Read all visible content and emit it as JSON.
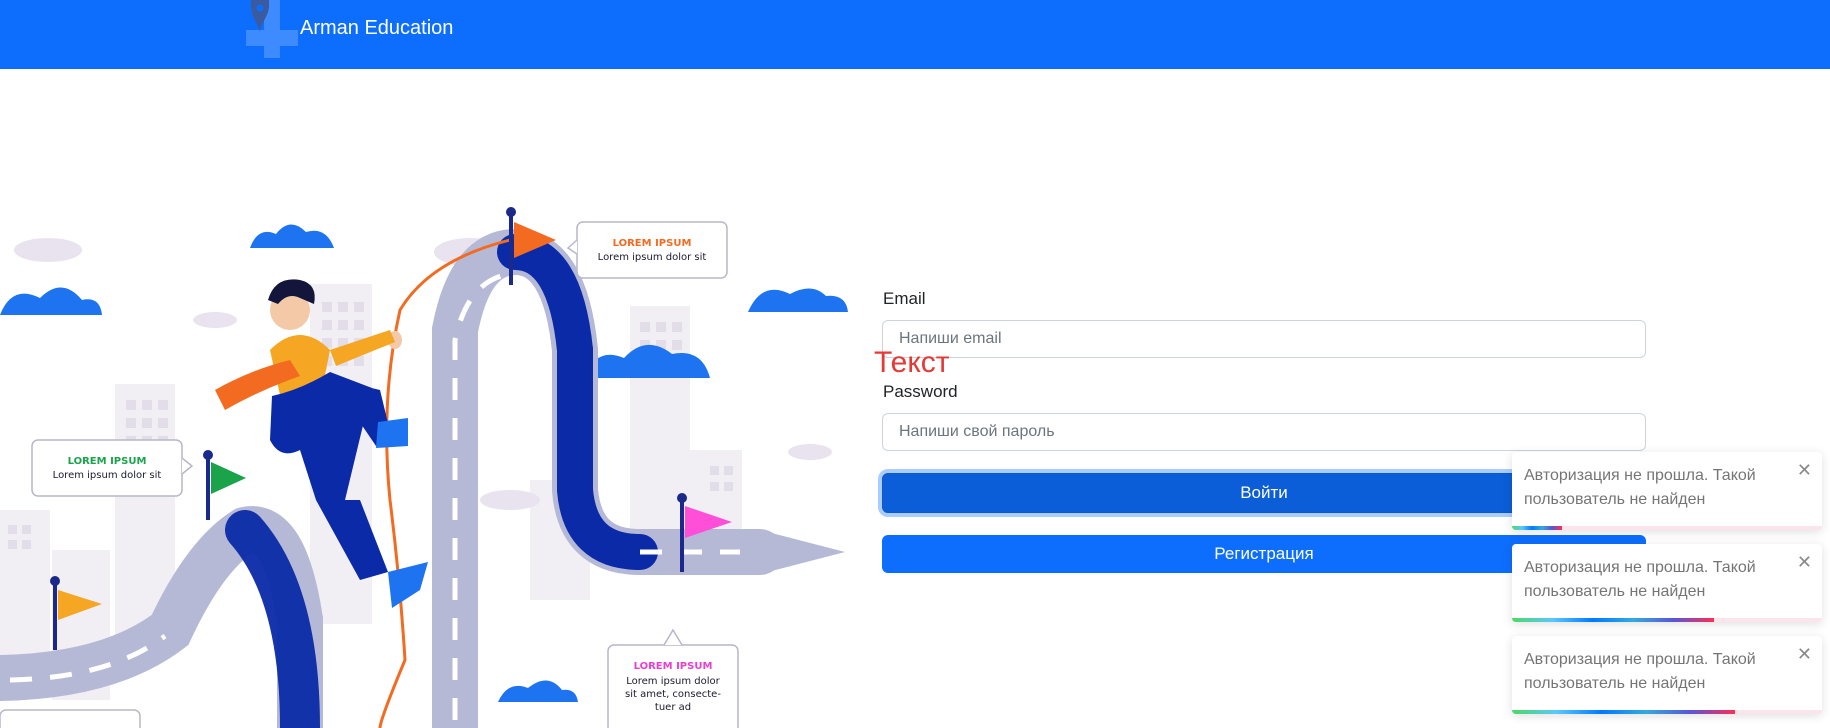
{
  "navbar": {
    "brand": "Arman Education",
    "logo_icon": "location-pin-cross-logo"
  },
  "illustration": {
    "callouts": [
      {
        "title": "LOREM IPSUM",
        "body": "Lorem ipsum dolor sit",
        "color": "#f26b21"
      },
      {
        "title": "LOREM IPSUM",
        "body": "Lorem ipsum dolor sit",
        "color": "#1aa34a"
      },
      {
        "title": "LOREM IPSUM",
        "body_lines": [
          "Lorem ipsum dolor",
          "sit amet, consecte-",
          "tuer ad"
        ],
        "color": "#e83fd0"
      }
    ]
  },
  "form": {
    "email_label": "Email",
    "email_placeholder": "Напиши email",
    "overlay_text": "Текст",
    "password_label": "Password",
    "password_placeholder": "Напиши свой пароль",
    "login_button": "Войти",
    "register_button": "Регистрация"
  },
  "toasts": [
    {
      "message": "Авторизация не прошла. Такой пользователь не найден",
      "close": "✕",
      "progress": 0.16
    },
    {
      "message": "Авторизация не прошла. Такой пользователь не найден",
      "close": "✕",
      "progress": 0.65
    },
    {
      "message": "Авторизация не прошла. Такой пользователь не найден",
      "close": "✕",
      "progress": 0.72
    }
  ],
  "colors": {
    "primary": "#0d6efd",
    "primary_dark": "#0b5ed7",
    "overlay_text": "#e53935",
    "toast_text": "#757575"
  }
}
